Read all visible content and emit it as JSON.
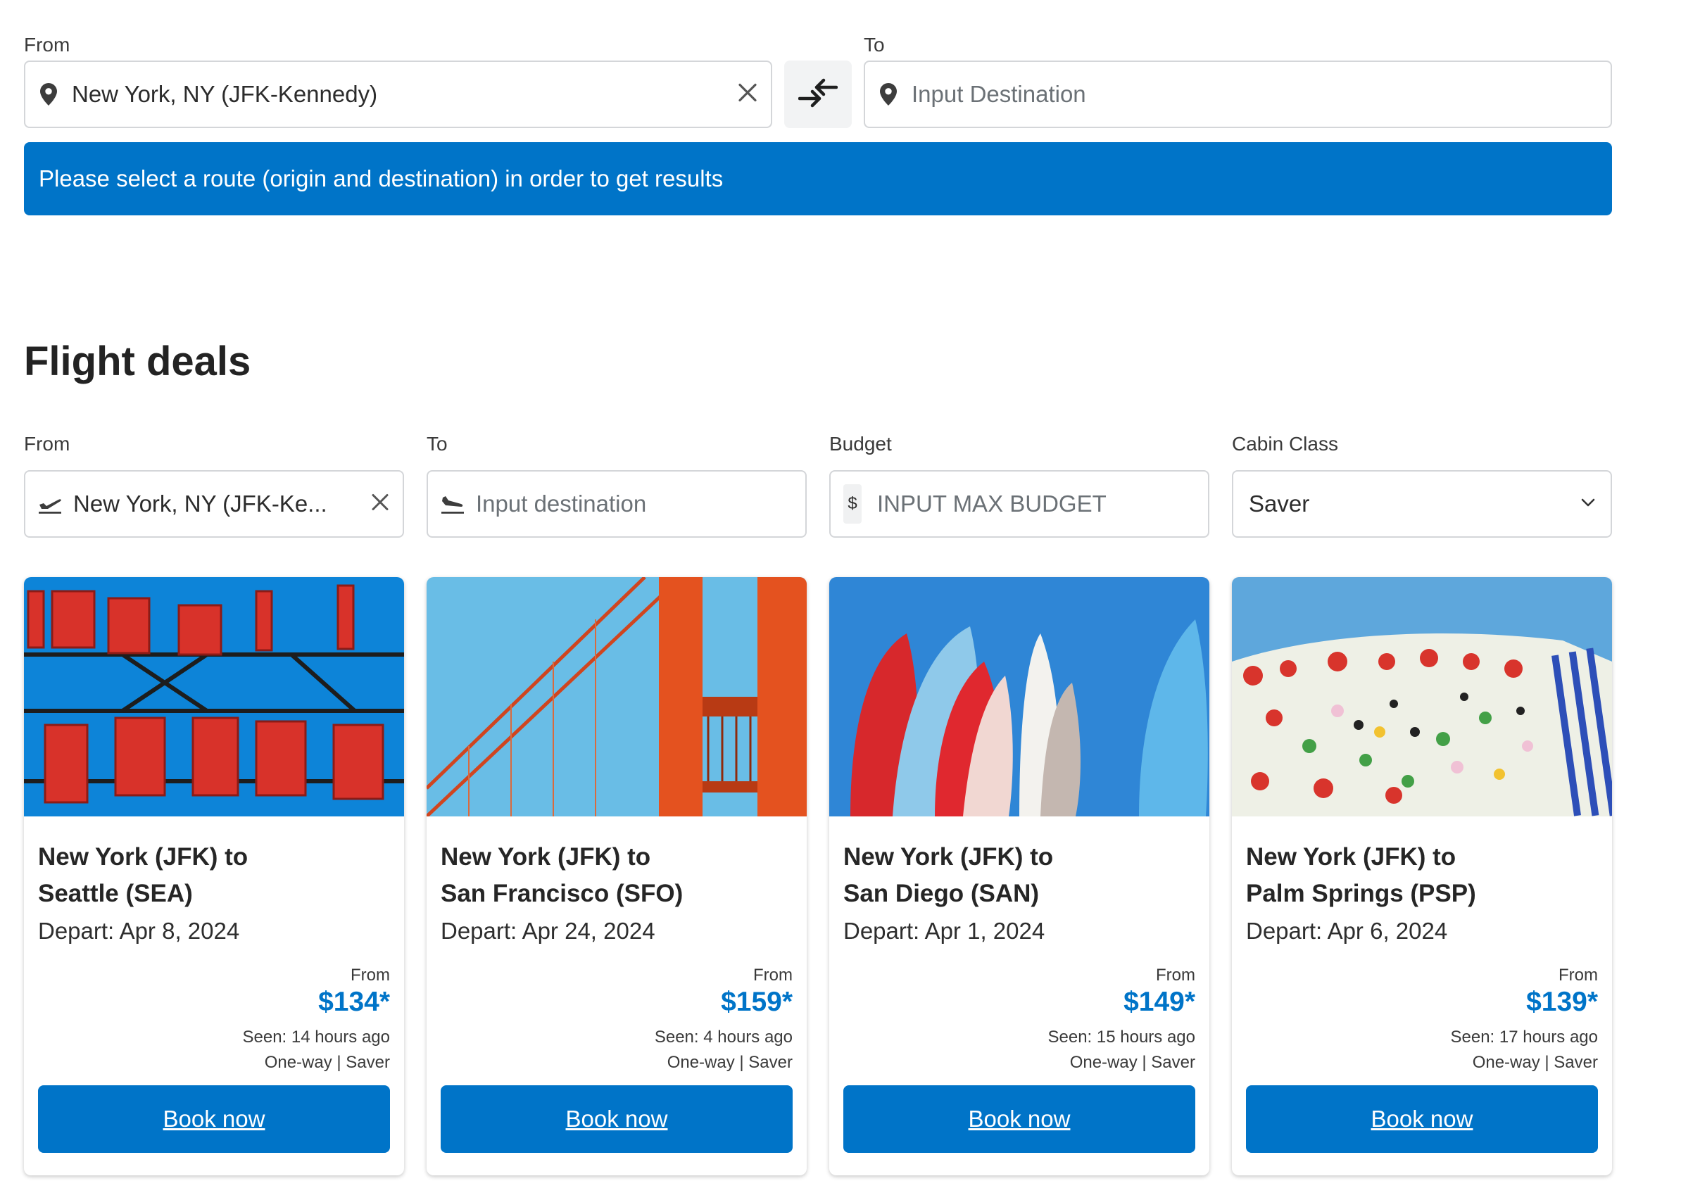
{
  "route_search": {
    "from_label": "From",
    "from_value": "New York, NY (JFK-Kennedy)",
    "to_label": "To",
    "to_placeholder": "Input Destination",
    "banner_text": "Please select a route (origin and destination) in order to get results"
  },
  "deals": {
    "title": "Flight deals",
    "filters": {
      "from_label": "From",
      "from_value": "New York, NY (JFK-Ke...",
      "to_label": "To",
      "to_placeholder": "Input destination",
      "budget_label": "Budget",
      "budget_currency": "$",
      "budget_placeholder": "INPUT MAX BUDGET",
      "cabin_label": "Cabin Class",
      "cabin_value": "Saver"
    },
    "cards": [
      {
        "route_line1": "New York (JFK) to",
        "route_line2": "Seattle (SEA)",
        "depart": "Depart: Apr 8, 2024",
        "from_label": "From",
        "price": "$134*",
        "seen": "Seen: 14 hours ago",
        "fare": "One-way | Saver",
        "button": "Book now"
      },
      {
        "route_line1": "New York (JFK) to",
        "route_line2": "San Francisco (SFO)",
        "depart": "Depart: Apr 24, 2024",
        "from_label": "From",
        "price": "$159*",
        "seen": "Seen: 4 hours ago",
        "fare": "One-way | Saver",
        "button": "Book now"
      },
      {
        "route_line1": "New York (JFK) to",
        "route_line2": "San Diego (SAN)",
        "depart": "Depart: Apr 1, 2024",
        "from_label": "From",
        "price": "$149*",
        "seen": "Seen: 15 hours ago",
        "fare": "One-way | Saver",
        "button": "Book now"
      },
      {
        "route_line1": "New York (JFK) to",
        "route_line2": "Palm Springs (PSP)",
        "depart": "Depart: Apr 6, 2024",
        "from_label": "From",
        "price": "$139*",
        "seen": "Seen: 17 hours ago",
        "fare": "One-way | Saver",
        "button": "Book now"
      }
    ]
  },
  "colors": {
    "brand_blue": "#0074c8",
    "border": "#d4d6d9",
    "text": "#2e2e2e"
  }
}
